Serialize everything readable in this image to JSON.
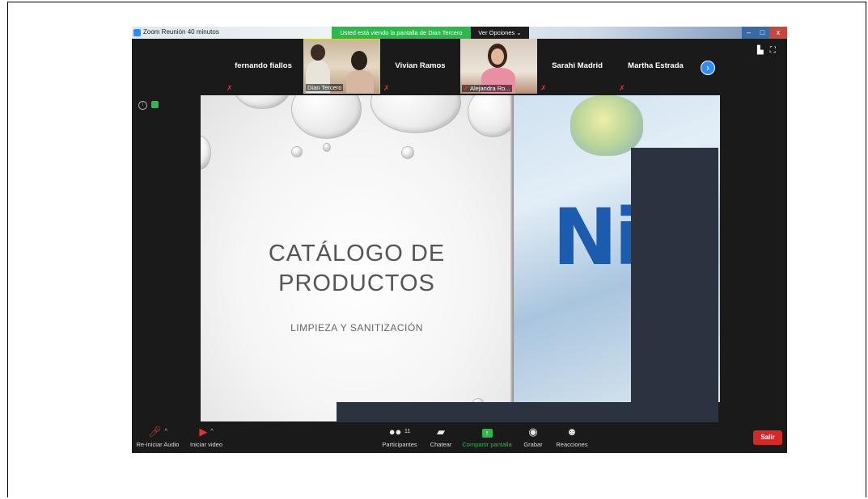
{
  "window": {
    "title": "Zoom Reunión 40 minutos",
    "share_banner": "Usted está viendo la pantalla de Dian Tercero",
    "view_options": "Ver Opciones",
    "minimize": "–",
    "maximize": "□",
    "close": "x"
  },
  "participants": [
    {
      "name": "fernando fiallos",
      "muted": true
    },
    {
      "name": "Dian Tercero",
      "video": true,
      "muted": false
    },
    {
      "name": "Vivian Ramos",
      "muted": true
    },
    {
      "name": "Alejandra Ro...",
      "video": true,
      "muted": true
    },
    {
      "name": "Sarahi Madrid",
      "muted": true
    },
    {
      "name": "Martha Estrada",
      "muted": true
    }
  ],
  "slide": {
    "title_line1": "CATÁLOGO DE",
    "title_line2": "PRODUCTOS",
    "subtitle": "LIMPIEZA Y SANITIZACIÓN",
    "brand_fragment": "Ni"
  },
  "toolbar": {
    "audio": "Re-Iniciar Audio",
    "video": "Iniciar video",
    "participants": "Participantes",
    "participants_count": "11",
    "chat": "Chatear",
    "share": "Compartir pantalla",
    "record": "Grabar",
    "reactions": "Reacciones",
    "leave": "Salir"
  },
  "colors": {
    "zoom_blue": "#2d8cff",
    "share_green": "#2db84b",
    "leave_red": "#d42929",
    "background": "#1a1a1a"
  }
}
